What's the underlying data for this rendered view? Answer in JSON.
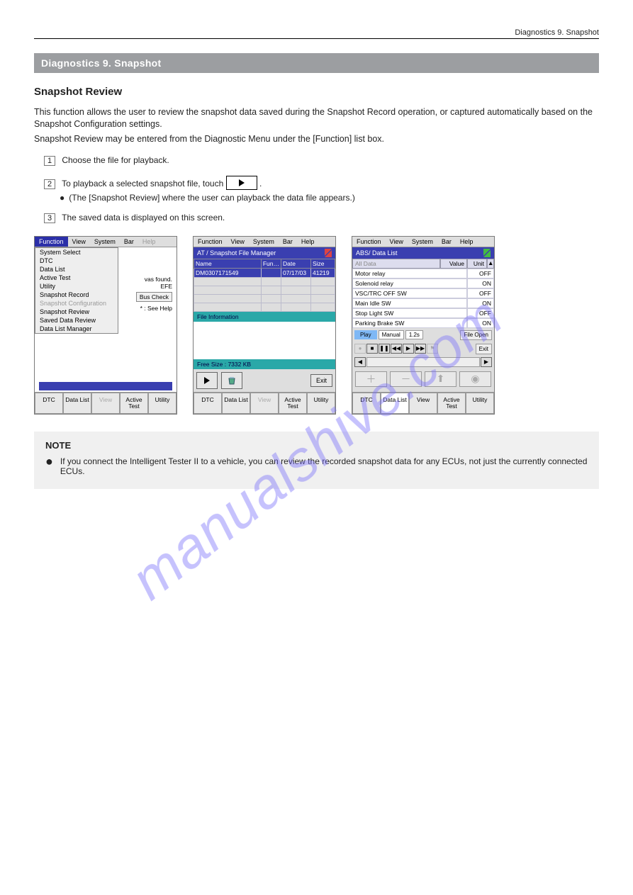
{
  "page": {
    "header_ref": "Diagnostics   9. Snapshot",
    "chapter": "Diagnostics   9. Snapshot",
    "title": "Snapshot Review",
    "intro1": "This function allows the user to review the snapshot data saved during the Snapshot Record operation, or captured automatically based on the Snapshot Configuration settings.",
    "intro2": "Snapshot Review may be entered from the Diagnostic Menu under the [Function] list box.",
    "step1": "Choose the file for playback.",
    "step2_a": "To playback a selected snapshot file, touch",
    "step2_b": ".",
    "step2_c": "(The [Snapshot Review] where the user can playback the data file appears.)",
    "step3": "The saved data is displayed on this screen."
  },
  "menubar": {
    "function": "Function",
    "view": "View",
    "system": "System",
    "bar": "Bar",
    "help": "Help"
  },
  "screen1": {
    "dropdown": [
      "System Select",
      "DTC",
      "Data List",
      "Active Test",
      "Utility",
      "Snapshot Record",
      "Snapshot Configuration",
      "Snapshot Review",
      "Saved Data Review",
      "Data List Manager"
    ],
    "behind_text1": "vas found.",
    "behind_text2": "EFE",
    "bus_check": "Bus Check",
    "see_help": "* : See Help"
  },
  "screen2": {
    "title": "AT / Snapshot File Manager",
    "cols": {
      "name": "Name",
      "fun": "Fun…",
      "date": "Date",
      "size": "Size"
    },
    "row": {
      "name": "DM0307171549",
      "fun": "",
      "date": "07/17/03",
      "size": "41219"
    },
    "file_info": "File Information",
    "free": "Free Size : 7332 KB",
    "exit": "Exit"
  },
  "screen3": {
    "title": "ABS/ Data List",
    "all_data": "All Data",
    "hdr_value": "Value",
    "hdr_unit": "Unit",
    "rows": [
      {
        "name": "Motor relay",
        "value": "OFF"
      },
      {
        "name": "Solenoid relay",
        "value": "ON"
      },
      {
        "name": "VSC/TRC OFF SW",
        "value": "OFF"
      },
      {
        "name": "Main Idle SW",
        "value": "ON"
      },
      {
        "name": "Stop Light SW",
        "value": "OFF"
      },
      {
        "name": "Parking Brake SW",
        "value": "ON"
      }
    ],
    "play": "Play",
    "mode": "Manual",
    "interval": "1.2s",
    "file_open": "File Open",
    "exit": "Exit"
  },
  "tabs": {
    "dtc": "DTC",
    "data": "Data List",
    "view": "View",
    "active": "Active Test",
    "utility": "Utility"
  },
  "note": {
    "title": "NOTE",
    "text": "If you connect the Intelligent Tester II to a vehicle, you can review the recorded snapshot data for any ECUs, not just the currently connected ECUs."
  },
  "watermark": "manualshive.com"
}
